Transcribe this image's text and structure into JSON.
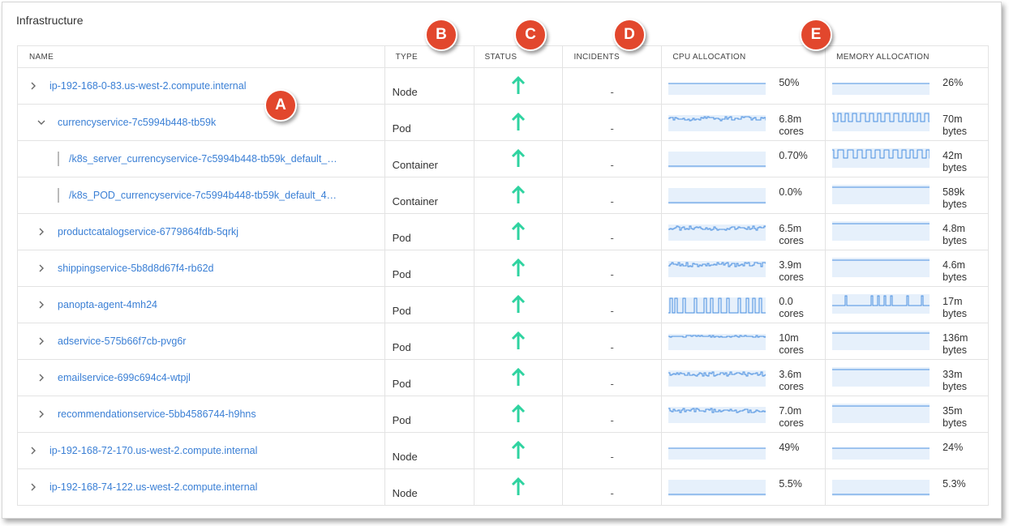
{
  "title": "Infrastructure",
  "columns": {
    "name": "NAME",
    "type": "TYPE",
    "status": "STATUS",
    "incidents": "INCIDENTS",
    "cpu": "CPU ALLOCATION",
    "memory": "MEMORY ALLOCATION"
  },
  "callouts": [
    "A",
    "B",
    "C",
    "D",
    "E"
  ],
  "colors": {
    "link": "#3a7fd5",
    "status_up": "#2fd3a0",
    "callout": "#e2472d",
    "spark_line": "#4a8fe0",
    "spark_fill": "#e6f0fb"
  },
  "rows": [
    {
      "name": "ip-192-168-0-83.us-west-2.compute.internal",
      "type": "Node",
      "status": "up-arrow-icon",
      "incidents": "-",
      "cpu": "50%",
      "cpu_unit": "",
      "mem": "26%",
      "mem_unit": "",
      "level": 0,
      "expander": "chevron-right",
      "cpu_spark": "flat",
      "mem_spark": "flat"
    },
    {
      "name": "currencyservice-7c5994b448-tb59k",
      "type": "Pod",
      "status": "up-arrow-icon",
      "incidents": "-",
      "cpu": "6.8m",
      "cpu_unit": "cores",
      "mem": "70m",
      "mem_unit": "bytes",
      "level": 1,
      "expander": "chevron-down",
      "cpu_spark": "noisy",
      "mem_spark": "sawtooth"
    },
    {
      "name": "/k8s_server_currencyservice-7c5994b448-tb59k_default_…",
      "type": "Container",
      "status": "up-arrow-icon",
      "incidents": "-",
      "cpu": "0.70%",
      "cpu_unit": "",
      "mem": "42m",
      "mem_unit": "bytes",
      "level": 2,
      "expander": "bar",
      "cpu_spark": "flat-low",
      "mem_spark": "sawtooth"
    },
    {
      "name": "/k8s_POD_currencyservice-7c5994b448-tb59k_default_4…",
      "type": "Container",
      "status": "up-arrow-icon",
      "incidents": "-",
      "cpu": "0.0%",
      "cpu_unit": "",
      "mem": "589k",
      "mem_unit": "bytes",
      "level": 2,
      "expander": "bar",
      "cpu_spark": "flat-low",
      "mem_spark": "flat-high"
    },
    {
      "name": "productcatalogservice-6779864fdb-5qrkj",
      "type": "Pod",
      "status": "up-arrow-icon",
      "incidents": "-",
      "cpu": "6.5m",
      "cpu_unit": "cores",
      "mem": "4.8m",
      "mem_unit": "bytes",
      "level": 1,
      "expander": "chevron-right",
      "cpu_spark": "noisy",
      "mem_spark": "flat-high"
    },
    {
      "name": "shippingservice-5b8d8d67f4-rb62d",
      "type": "Pod",
      "status": "up-arrow-icon",
      "incidents": "-",
      "cpu": "3.9m",
      "cpu_unit": "cores",
      "mem": "4.6m",
      "mem_unit": "bytes",
      "level": 1,
      "expander": "chevron-right",
      "cpu_spark": "noisy",
      "mem_spark": "flat-high"
    },
    {
      "name": "panopta-agent-4mh24",
      "type": "Pod",
      "status": "up-arrow-icon",
      "incidents": "-",
      "cpu": "0.0",
      "cpu_unit": "cores",
      "mem": "17m",
      "mem_unit": "bytes",
      "level": 1,
      "expander": "chevron-right",
      "cpu_spark": "spikes",
      "mem_spark": "spikes-thin"
    },
    {
      "name": "adservice-575b66f7cb-pvg6r",
      "type": "Pod",
      "status": "up-arrow-icon",
      "incidents": "-",
      "cpu": "10m",
      "cpu_unit": "cores",
      "mem": "136m",
      "mem_unit": "bytes",
      "level": 1,
      "expander": "chevron-right",
      "cpu_spark": "noisy-flat",
      "mem_spark": "flat-high"
    },
    {
      "name": "emailservice-699c694c4-wtpjl",
      "type": "Pod",
      "status": "up-arrow-icon",
      "incidents": "-",
      "cpu": "3.6m",
      "cpu_unit": "cores",
      "mem": "33m",
      "mem_unit": "bytes",
      "level": 1,
      "expander": "chevron-right",
      "cpu_spark": "noisy",
      "mem_spark": "flat-high"
    },
    {
      "name": "recommendationservice-5bb4586744-h9hns",
      "type": "Pod",
      "status": "up-arrow-icon",
      "incidents": "-",
      "cpu": "7.0m",
      "cpu_unit": "cores",
      "mem": "35m",
      "mem_unit": "bytes",
      "level": 1,
      "expander": "chevron-right",
      "cpu_spark": "noisy",
      "mem_spark": "flat-high"
    },
    {
      "name": "ip-192-168-72-170.us-west-2.compute.internal",
      "type": "Node",
      "status": "up-arrow-icon",
      "incidents": "-",
      "cpu": "49%",
      "cpu_unit": "",
      "mem": "24%",
      "mem_unit": "",
      "level": 0,
      "expander": "chevron-right",
      "cpu_spark": "flat",
      "mem_spark": "flat"
    },
    {
      "name": "ip-192-168-74-122.us-west-2.compute.internal",
      "type": "Node",
      "status": "up-arrow-icon",
      "incidents": "-",
      "cpu": "5.5%",
      "cpu_unit": "",
      "mem": "5.3%",
      "mem_unit": "",
      "level": 0,
      "expander": "chevron-right",
      "cpu_spark": "flat-low",
      "mem_spark": "flat-low"
    }
  ]
}
